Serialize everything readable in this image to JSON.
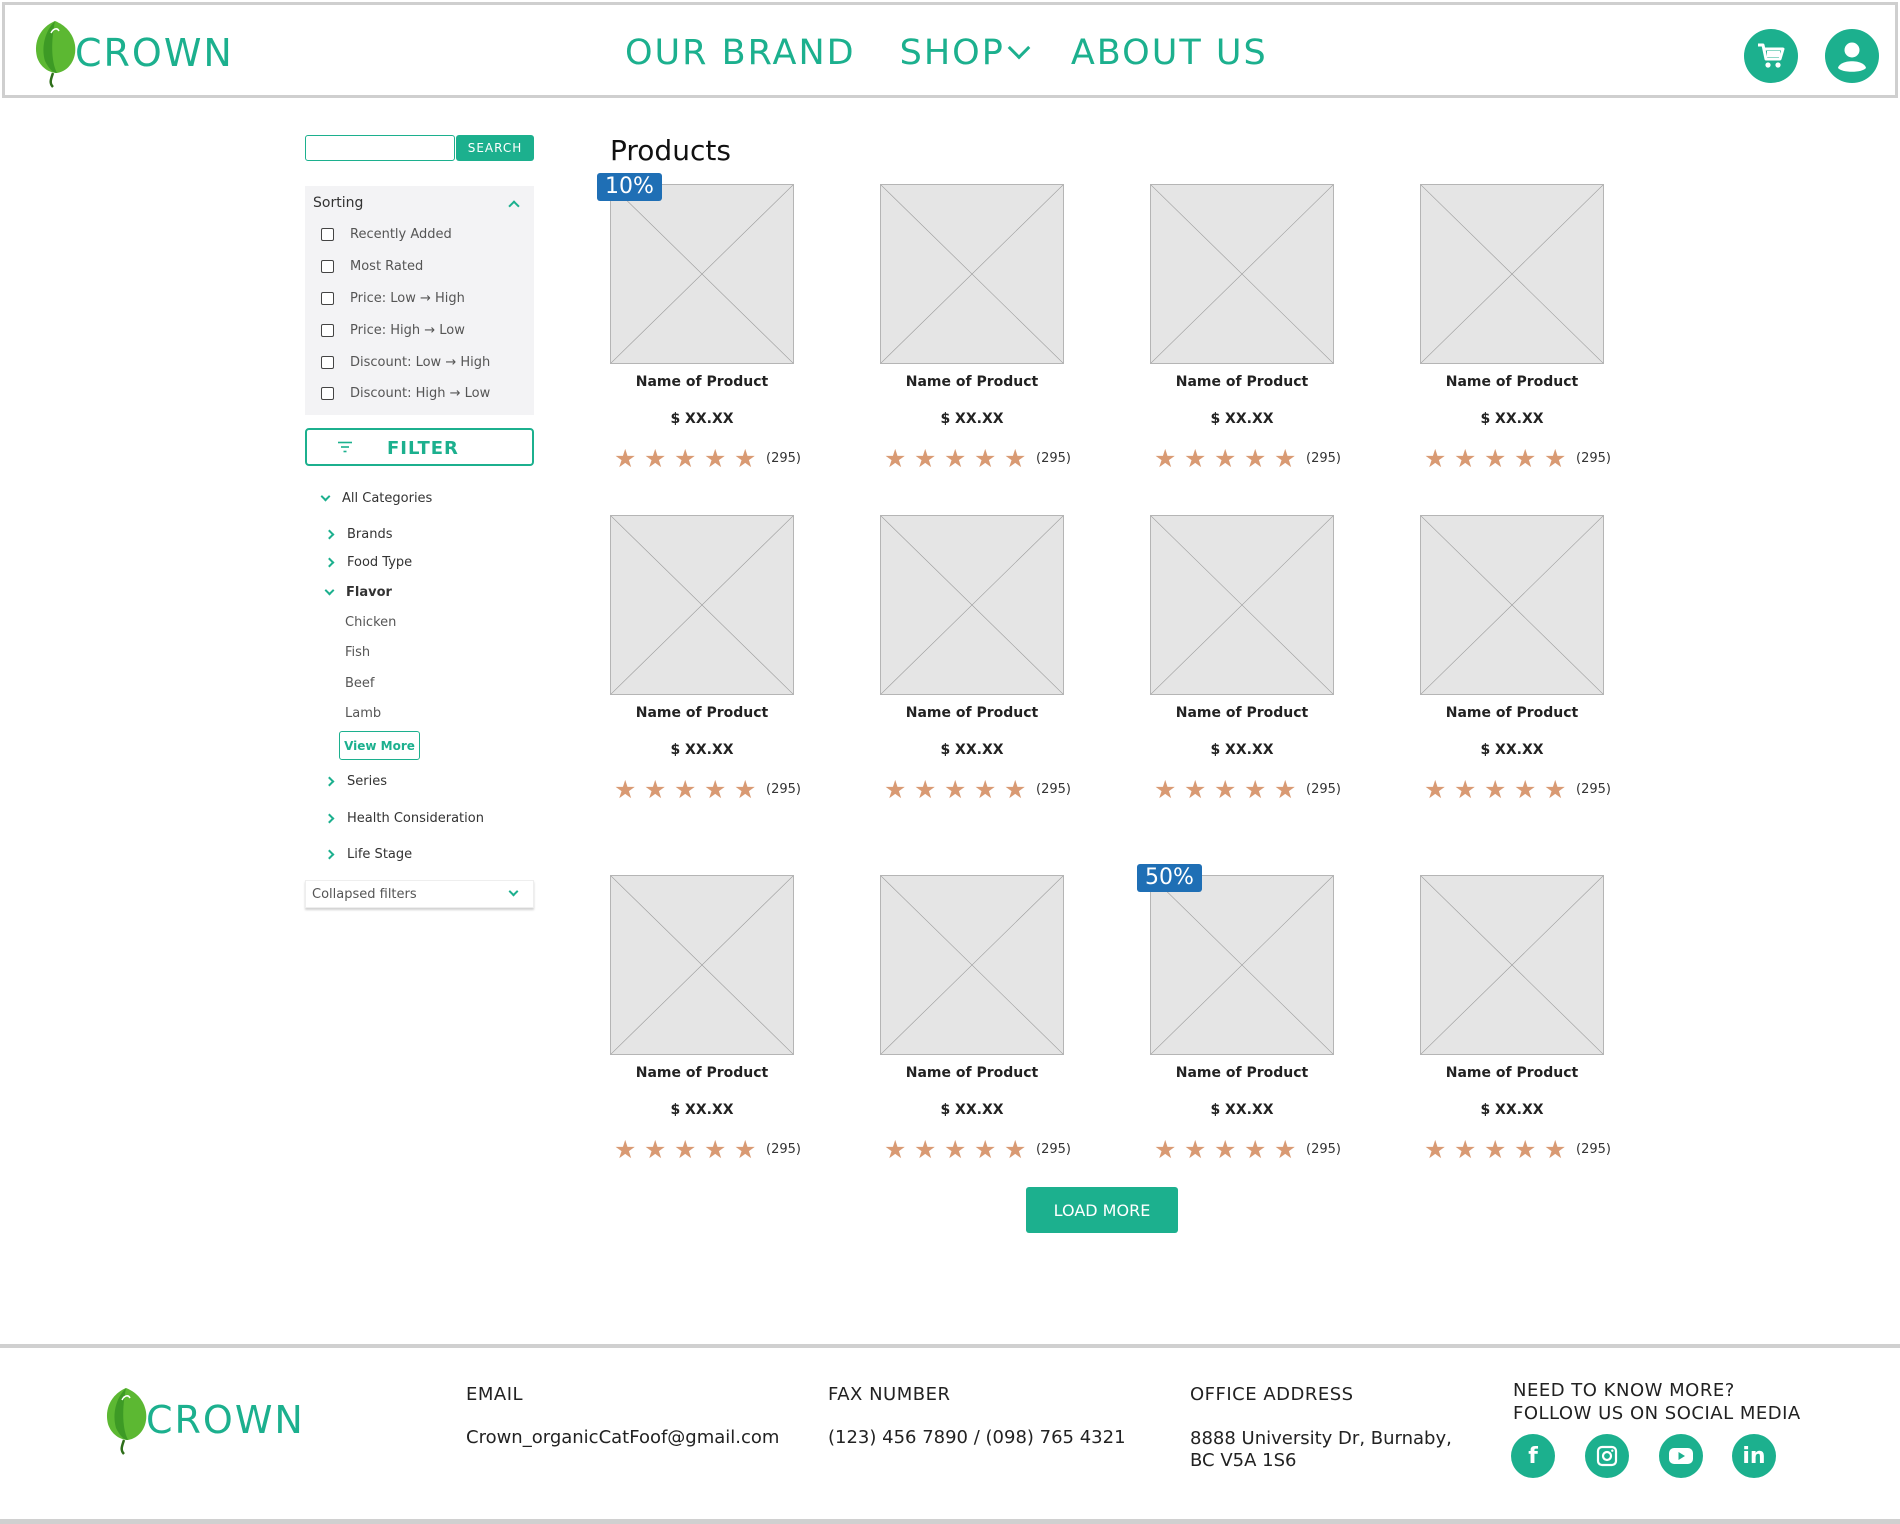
{
  "brand": {
    "name": "CROWN"
  },
  "nav": {
    "items": [
      "OUR BRAND",
      "SHOP",
      "ABOUT US"
    ]
  },
  "search": {
    "button_label": "SEARCH",
    "placeholder": ""
  },
  "sorting": {
    "title": "Sorting",
    "options": [
      "Recently Added",
      "Most Rated",
      "Price: Low → High",
      "Price: High → Low",
      "Discount: Low → High",
      "Discount: High → Low"
    ]
  },
  "filter": {
    "label": "FILTER"
  },
  "categories": {
    "all": "All Categories",
    "items": [
      "Brands",
      "Food Type",
      "Flavor",
      "Series",
      "Health Consideration",
      "Life Stage"
    ],
    "flavor_options": [
      "Chicken",
      "Fish",
      "Beef",
      "Lamb"
    ],
    "view_more": "View More",
    "collapsed_label": "Collapsed filters"
  },
  "products": {
    "title": "Products",
    "items": [
      {
        "name": "Name of Product",
        "price": "$ XX.XX",
        "reviews": "(295)",
        "rating": 5,
        "badge": "10%"
      },
      {
        "name": "Name of Product",
        "price": "$ XX.XX",
        "reviews": "(295)",
        "rating": 5,
        "badge": ""
      },
      {
        "name": "Name of Product",
        "price": "$ XX.XX",
        "reviews": "(295)",
        "rating": 5,
        "badge": ""
      },
      {
        "name": "Name of Product",
        "price": "$ XX.XX",
        "reviews": "(295)",
        "rating": 5,
        "badge": ""
      },
      {
        "name": "Name of Product",
        "price": "$ XX.XX",
        "reviews": "(295)",
        "rating": 5,
        "badge": ""
      },
      {
        "name": "Name of Product",
        "price": "$ XX.XX",
        "reviews": "(295)",
        "rating": 5,
        "badge": ""
      },
      {
        "name": "Name of Product",
        "price": "$ XX.XX",
        "reviews": "(295)",
        "rating": 5,
        "badge": ""
      },
      {
        "name": "Name of Product",
        "price": "$ XX.XX",
        "reviews": "(295)",
        "rating": 5,
        "badge": ""
      },
      {
        "name": "Name of Product",
        "price": "$ XX.XX",
        "reviews": "(295)",
        "rating": 5,
        "badge": ""
      },
      {
        "name": "Name of Product",
        "price": "$ XX.XX",
        "reviews": "(295)",
        "rating": 5,
        "badge": ""
      },
      {
        "name": "Name of Product",
        "price": "$ XX.XX",
        "reviews": "(295)",
        "rating": 5,
        "badge": "50%"
      },
      {
        "name": "Name of Product",
        "price": "$ XX.XX",
        "reviews": "(295)",
        "rating": 5,
        "badge": ""
      }
    ],
    "load_more": "LOAD MORE"
  },
  "footer": {
    "email_label": "EMAIL",
    "email": "Crown_organicCatFoof@gmail.com",
    "fax_label": "FAX NUMBER",
    "fax": "(123) 456 7890 / (098) 765 4321",
    "office_label": "OFFICE ADDRESS",
    "office_line1": "8888 University Dr, Burnaby,",
    "office_line2": "BC V5A 1S6",
    "social_line1": "NEED TO KNOW MORE?",
    "social_line2": "FOLLOW US ON SOCIAL MEDIA",
    "social": [
      "facebook-icon",
      "instagram-icon",
      "youtube-icon",
      "linkedin-icon"
    ]
  },
  "colors": {
    "accent": "#1cb08e",
    "badge": "#1f6fb5",
    "star": "#d99a73",
    "placeholder": "#e5e5e5"
  }
}
